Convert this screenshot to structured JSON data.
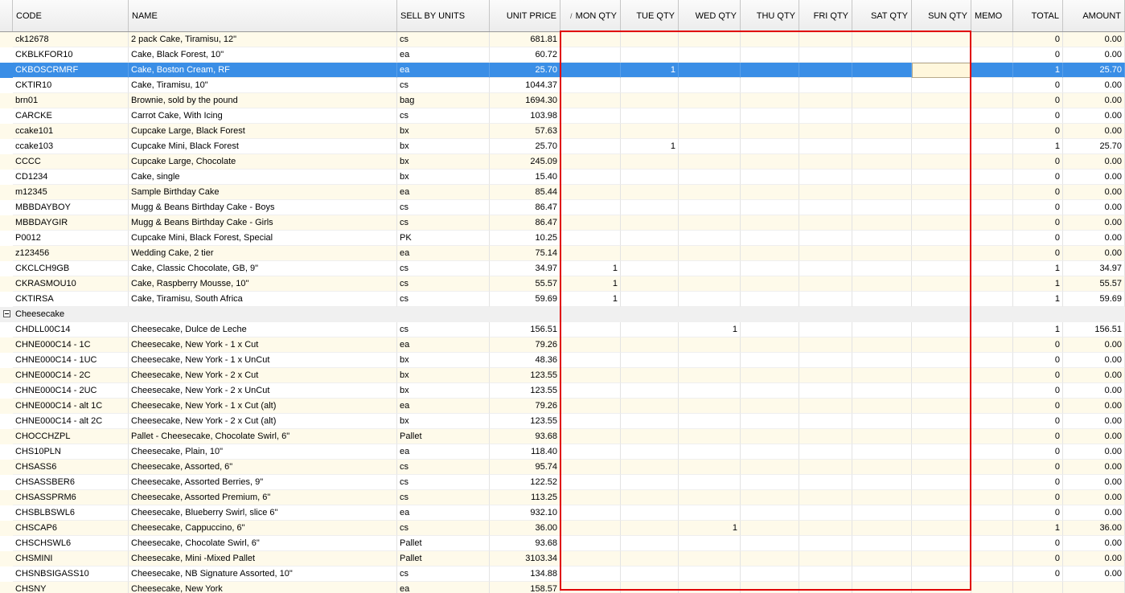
{
  "columns": [
    {
      "key": "code",
      "label": "CODE",
      "align": "left"
    },
    {
      "key": "name",
      "label": "NAME",
      "align": "left"
    },
    {
      "key": "unit",
      "label": "SELL BY UNITS",
      "align": "left"
    },
    {
      "key": "price",
      "label": "UNIT PRICE",
      "align": "right"
    },
    {
      "key": "mon",
      "label": "MON QTY",
      "align": "right"
    },
    {
      "key": "tue",
      "label": "TUE QTY",
      "align": "right"
    },
    {
      "key": "wed",
      "label": "WED QTY",
      "align": "right"
    },
    {
      "key": "thu",
      "label": "THU QTY",
      "align": "right"
    },
    {
      "key": "fri",
      "label": "FRI QTY",
      "align": "right"
    },
    {
      "key": "sat",
      "label": "SAT QTY",
      "align": "right"
    },
    {
      "key": "sun",
      "label": "SUN QTY",
      "align": "right"
    },
    {
      "key": "memo",
      "label": "MEMO",
      "align": "left"
    },
    {
      "key": "total",
      "label": "TOTAL",
      "align": "right"
    },
    {
      "key": "amount",
      "label": "AMOUNT",
      "align": "right"
    }
  ],
  "sort_indicator": "/",
  "colors": {
    "selection": "#3a8ee6",
    "stripe": "#fefaea",
    "highlight": "#e00000"
  },
  "selected_row": 2,
  "rows": [
    {
      "code": "ck12678",
      "name": "2 pack Cake, Tiramisu, 12\"",
      "unit": "cs",
      "price": "681.81",
      "mon": "",
      "tue": "",
      "wed": "",
      "thu": "",
      "fri": "",
      "sat": "",
      "sun": "",
      "memo": "",
      "total": "0",
      "amount": "0.00"
    },
    {
      "code": "CKBLKFOR10",
      "name": "Cake, Black Forest, 10\"",
      "unit": "ea",
      "price": "60.72",
      "mon": "",
      "tue": "",
      "wed": "",
      "thu": "",
      "fri": "",
      "sat": "",
      "sun": "",
      "memo": "",
      "total": "0",
      "amount": "0.00"
    },
    {
      "code": "CKBOSCRMRF",
      "name": "Cake, Boston Cream, RF",
      "unit": "ea",
      "price": "25.70",
      "mon": "",
      "tue": "1",
      "wed": "",
      "thu": "",
      "fri": "",
      "sat": "",
      "sun": "",
      "memo": "",
      "total": "1",
      "amount": "25.70"
    },
    {
      "code": "CKTIR10",
      "name": "Cake, Tiramisu, 10\"",
      "unit": "cs",
      "price": "1044.37",
      "mon": "",
      "tue": "",
      "wed": "",
      "thu": "",
      "fri": "",
      "sat": "",
      "sun": "",
      "memo": "",
      "total": "0",
      "amount": "0.00"
    },
    {
      "code": "brn01",
      "name": "Brownie, sold by the pound",
      "unit": "bag",
      "price": "1694.30",
      "mon": "",
      "tue": "",
      "wed": "",
      "thu": "",
      "fri": "",
      "sat": "",
      "sun": "",
      "memo": "",
      "total": "0",
      "amount": "0.00"
    },
    {
      "code": "CARCKE",
      "name": "Carrot Cake, With Icing",
      "unit": "cs",
      "price": "103.98",
      "mon": "",
      "tue": "",
      "wed": "",
      "thu": "",
      "fri": "",
      "sat": "",
      "sun": "",
      "memo": "",
      "total": "0",
      "amount": "0.00"
    },
    {
      "code": "ccake101",
      "name": "Cupcake Large, Black Forest",
      "unit": "bx",
      "price": "57.63",
      "mon": "",
      "tue": "",
      "wed": "",
      "thu": "",
      "fri": "",
      "sat": "",
      "sun": "",
      "memo": "",
      "total": "0",
      "amount": "0.00"
    },
    {
      "code": "ccake103",
      "name": "Cupcake Mini, Black Forest",
      "unit": "bx",
      "price": "25.70",
      "mon": "",
      "tue": "1",
      "wed": "",
      "thu": "",
      "fri": "",
      "sat": "",
      "sun": "",
      "memo": "",
      "total": "1",
      "amount": "25.70"
    },
    {
      "code": "CCCC",
      "name": "Cupcake Large, Chocolate",
      "unit": "bx",
      "price": "245.09",
      "mon": "",
      "tue": "",
      "wed": "",
      "thu": "",
      "fri": "",
      "sat": "",
      "sun": "",
      "memo": "",
      "total": "0",
      "amount": "0.00"
    },
    {
      "code": "CD1234",
      "name": "Cake, single",
      "unit": "bx",
      "price": "15.40",
      "mon": "",
      "tue": "",
      "wed": "",
      "thu": "",
      "fri": "",
      "sat": "",
      "sun": "",
      "memo": "",
      "total": "0",
      "amount": "0.00"
    },
    {
      "code": "m12345",
      "name": "Sample Birthday Cake",
      "unit": "ea",
      "price": "85.44",
      "mon": "",
      "tue": "",
      "wed": "",
      "thu": "",
      "fri": "",
      "sat": "",
      "sun": "",
      "memo": "",
      "total": "0",
      "amount": "0.00"
    },
    {
      "code": "MBBDAYBOY",
      "name": "Mugg & Beans Birthday Cake - Boys",
      "unit": "cs",
      "price": "86.47",
      "mon": "",
      "tue": "",
      "wed": "",
      "thu": "",
      "fri": "",
      "sat": "",
      "sun": "",
      "memo": "",
      "total": "0",
      "amount": "0.00"
    },
    {
      "code": "MBBDAYGIR",
      "name": "Mugg & Beans Birthday Cake - Girls",
      "unit": "cs",
      "price": "86.47",
      "mon": "",
      "tue": "",
      "wed": "",
      "thu": "",
      "fri": "",
      "sat": "",
      "sun": "",
      "memo": "",
      "total": "0",
      "amount": "0.00"
    },
    {
      "code": "P0012",
      "name": "Cupcake Mini, Black Forest, Special",
      "unit": "PK",
      "price": "10.25",
      "mon": "",
      "tue": "",
      "wed": "",
      "thu": "",
      "fri": "",
      "sat": "",
      "sun": "",
      "memo": "",
      "total": "0",
      "amount": "0.00"
    },
    {
      "code": "z123456",
      "name": "Wedding Cake, 2 tier",
      "unit": "ea",
      "price": "75.14",
      "mon": "",
      "tue": "",
      "wed": "",
      "thu": "",
      "fri": "",
      "sat": "",
      "sun": "",
      "memo": "",
      "total": "0",
      "amount": "0.00"
    },
    {
      "code": "CKCLCH9GB",
      "name": "Cake, Classic Chocolate, GB, 9\"",
      "unit": "cs",
      "price": "34.97",
      "mon": "1",
      "tue": "",
      "wed": "",
      "thu": "",
      "fri": "",
      "sat": "",
      "sun": "",
      "memo": "",
      "total": "1",
      "amount": "34.97"
    },
    {
      "code": "CKRASMOU10",
      "name": "Cake, Raspberry Mousse, 10\"",
      "unit": "cs",
      "price": "55.57",
      "mon": "1",
      "tue": "",
      "wed": "",
      "thu": "",
      "fri": "",
      "sat": "",
      "sun": "",
      "memo": "",
      "total": "1",
      "amount": "55.57"
    },
    {
      "code": "CKTIRSA",
      "name": "Cake, Tiramisu, South Africa",
      "unit": "cs",
      "price": "59.69",
      "mon": "1",
      "tue": "",
      "wed": "",
      "thu": "",
      "fri": "",
      "sat": "",
      "sun": "",
      "memo": "",
      "total": "1",
      "amount": "59.69"
    },
    {
      "group": "Cheesecake"
    },
    {
      "code": "CHDLL00C14",
      "name": "Cheesecake, Dulce de Leche",
      "unit": "cs",
      "price": "156.51",
      "mon": "",
      "tue": "",
      "wed": "1",
      "thu": "",
      "fri": "",
      "sat": "",
      "sun": "",
      "memo": "",
      "total": "1",
      "amount": "156.51"
    },
    {
      "code": "CHNE000C14 - 1C",
      "name": "Cheesecake, New York - 1 x Cut",
      "unit": "ea",
      "price": "79.26",
      "mon": "",
      "tue": "",
      "wed": "",
      "thu": "",
      "fri": "",
      "sat": "",
      "sun": "",
      "memo": "",
      "total": "0",
      "amount": "0.00"
    },
    {
      "code": "CHNE000C14 - 1UC",
      "name": "Cheesecake, New York - 1 x UnCut",
      "unit": "bx",
      "price": "48.36",
      "mon": "",
      "tue": "",
      "wed": "",
      "thu": "",
      "fri": "",
      "sat": "",
      "sun": "",
      "memo": "",
      "total": "0",
      "amount": "0.00"
    },
    {
      "code": "CHNE000C14 - 2C",
      "name": "Cheesecake, New York - 2 x Cut",
      "unit": "bx",
      "price": "123.55",
      "mon": "",
      "tue": "",
      "wed": "",
      "thu": "",
      "fri": "",
      "sat": "",
      "sun": "",
      "memo": "",
      "total": "0",
      "amount": "0.00"
    },
    {
      "code": "CHNE000C14 - 2UC",
      "name": "Cheesecake, New York - 2 x UnCut",
      "unit": "bx",
      "price": "123.55",
      "mon": "",
      "tue": "",
      "wed": "",
      "thu": "",
      "fri": "",
      "sat": "",
      "sun": "",
      "memo": "",
      "total": "0",
      "amount": "0.00"
    },
    {
      "code": "CHNE000C14 - alt 1C",
      "name": "Cheesecake, New York - 1 x Cut (alt)",
      "unit": "ea",
      "price": "79.26",
      "mon": "",
      "tue": "",
      "wed": "",
      "thu": "",
      "fri": "",
      "sat": "",
      "sun": "",
      "memo": "",
      "total": "0",
      "amount": "0.00"
    },
    {
      "code": "CHNE000C14 - alt 2C",
      "name": "Cheesecake, New York - 2 x Cut (alt)",
      "unit": "bx",
      "price": "123.55",
      "mon": "",
      "tue": "",
      "wed": "",
      "thu": "",
      "fri": "",
      "sat": "",
      "sun": "",
      "memo": "",
      "total": "0",
      "amount": "0.00"
    },
    {
      "code": "CHOCCHZPL",
      "name": "Pallet - Cheesecake, Chocolate Swirl, 6\"",
      "unit": "Pallet",
      "price": "93.68",
      "mon": "",
      "tue": "",
      "wed": "",
      "thu": "",
      "fri": "",
      "sat": "",
      "sun": "",
      "memo": "",
      "total": "0",
      "amount": "0.00"
    },
    {
      "code": "CHS10PLN",
      "name": "Cheesecake, Plain, 10\"",
      "unit": "ea",
      "price": "118.40",
      "mon": "",
      "tue": "",
      "wed": "",
      "thu": "",
      "fri": "",
      "sat": "",
      "sun": "",
      "memo": "",
      "total": "0",
      "amount": "0.00"
    },
    {
      "code": "CHSASS6",
      "name": "Cheesecake, Assorted, 6\"",
      "unit": "cs",
      "price": "95.74",
      "mon": "",
      "tue": "",
      "wed": "",
      "thu": "",
      "fri": "",
      "sat": "",
      "sun": "",
      "memo": "",
      "total": "0",
      "amount": "0.00"
    },
    {
      "code": "CHSASSBER6",
      "name": "Cheesecake, Assorted Berries, 9\"",
      "unit": "cs",
      "price": "122.52",
      "mon": "",
      "tue": "",
      "wed": "",
      "thu": "",
      "fri": "",
      "sat": "",
      "sun": "",
      "memo": "",
      "total": "0",
      "amount": "0.00"
    },
    {
      "code": "CHSASSPRM6",
      "name": "Cheesecake, Assorted Premium, 6\"",
      "unit": "cs",
      "price": "113.25",
      "mon": "",
      "tue": "",
      "wed": "",
      "thu": "",
      "fri": "",
      "sat": "",
      "sun": "",
      "memo": "",
      "total": "0",
      "amount": "0.00"
    },
    {
      "code": "CHSBLBSWL6",
      "name": "Cheesecake, Blueberry Swirl, slice  6\"",
      "unit": "ea",
      "price": "932.10",
      "mon": "",
      "tue": "",
      "wed": "",
      "thu": "",
      "fri": "",
      "sat": "",
      "sun": "",
      "memo": "",
      "total": "0",
      "amount": "0.00"
    },
    {
      "code": "CHSCAP6",
      "name": "Cheesecake, Cappuccino, 6\"",
      "unit": "cs",
      "price": "36.00",
      "mon": "",
      "tue": "",
      "wed": "1",
      "thu": "",
      "fri": "",
      "sat": "",
      "sun": "",
      "memo": "",
      "total": "1",
      "amount": "36.00"
    },
    {
      "code": "CHSCHSWL6",
      "name": "Cheesecake, Chocolate Swirl, 6\"",
      "unit": "Pallet",
      "price": "93.68",
      "mon": "",
      "tue": "",
      "wed": "",
      "thu": "",
      "fri": "",
      "sat": "",
      "sun": "",
      "memo": "",
      "total": "0",
      "amount": "0.00"
    },
    {
      "code": "CHSMINI",
      "name": "Cheesecake, Mini -Mixed Pallet",
      "unit": "Pallet",
      "price": "3103.34",
      "mon": "",
      "tue": "",
      "wed": "",
      "thu": "",
      "fri": "",
      "sat": "",
      "sun": "",
      "memo": "",
      "total": "0",
      "amount": "0.00"
    },
    {
      "code": "CHSNBSIGASS10",
      "name": "Cheesecake, NB Signature Assorted, 10\"",
      "unit": "cs",
      "price": "134.88",
      "mon": "",
      "tue": "",
      "wed": "",
      "thu": "",
      "fri": "",
      "sat": "",
      "sun": "",
      "memo": "",
      "total": "0",
      "amount": "0.00"
    },
    {
      "code": "CHSNY",
      "name": "Cheesecake, New York",
      "unit": "ea",
      "price": "158.57",
      "mon": "",
      "tue": "",
      "wed": "",
      "thu": "",
      "fri": "",
      "sat": "",
      "sun": "",
      "memo": "",
      "total": "",
      "amount": ""
    }
  ]
}
